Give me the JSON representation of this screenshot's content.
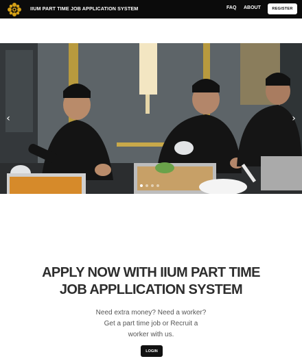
{
  "navbar": {
    "logo_icon": "ornamental-flower-logo",
    "brand": "IIUM PART TIME JOB APPLICATION SYSTEM",
    "links": [
      "FAQ",
      "ABOUT"
    ],
    "register_label": "REGISTER"
  },
  "carousel": {
    "prev_icon": "chevron-left-icon",
    "next_icon": "chevron-right-icon",
    "slide_count": 4,
    "active_slide": 1
  },
  "hero": {
    "title_line1": "APPLY NOW WITH IIUM PART TIME",
    "title_line2": "JOB APPLLICATION SYSTEM",
    "text_line1": "Need extra money? Need a worker?",
    "text_line2": "Get a part time job or Recruit a",
    "text_line3": "worker with us.",
    "login_label": "LOGIN"
  },
  "colors": {
    "navbar_bg": "#0b0b0b",
    "logo_gold": "#d4a017",
    "title_text": "#2d2d2d"
  }
}
